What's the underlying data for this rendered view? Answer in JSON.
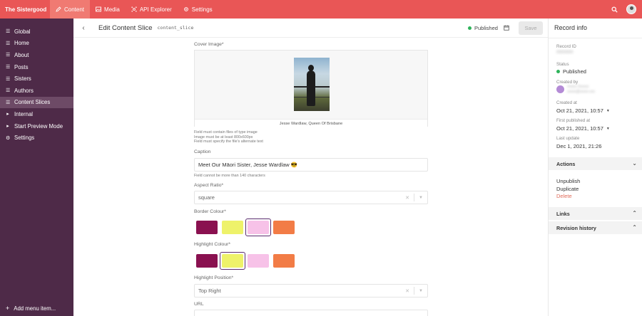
{
  "brand": "The Sistergood",
  "nav": {
    "content": "Content",
    "media": "Media",
    "api_explorer": "API Explorer",
    "settings": "Settings"
  },
  "sidebar": {
    "items": [
      {
        "label": "Global",
        "icon": "list-icon"
      },
      {
        "label": "Home",
        "icon": "list-icon"
      },
      {
        "label": "About",
        "icon": "list-icon"
      },
      {
        "label": "Posts",
        "icon": "list-icon"
      },
      {
        "label": "Sisters",
        "icon": "list-icon"
      },
      {
        "label": "Authors",
        "icon": "list-icon"
      },
      {
        "label": "Content Slices",
        "icon": "list-icon"
      },
      {
        "label": "Internal",
        "icon": "caret-right-icon"
      },
      {
        "label": "Start Preview Mode",
        "icon": "caret-right-icon"
      },
      {
        "label": "Settings",
        "icon": "gear-icon"
      }
    ],
    "add_menu": "Add menu item..."
  },
  "header": {
    "title": "Edit Content Slice",
    "code": "content_slice",
    "status": "Published",
    "save": "Save"
  },
  "form": {
    "cover_label": "Cover Image*",
    "cover_caption": "Jesse Wardlaw, Queen Of Brisbane",
    "cover_hints": [
      "Field must contain files of type image",
      "Image must be at least 800x600px",
      "Field must specify the file's alternate text"
    ],
    "caption_label": "Caption",
    "caption_value": "Meet Our Māori Sister, Jesse Wardlaw 😎",
    "caption_hint": "Field cannot be more than 140 characters",
    "aspect_label": "Aspect Ratio*",
    "aspect_value": "square",
    "border_label": "Border Colour*",
    "highlight_label": "Highlight Colour*",
    "position_label": "Highlight Position*",
    "position_value": "Top Right",
    "url_label": "URL",
    "swatch_colors": [
      "#8a1150",
      "#eef26a",
      "#f7c2e8",
      "#f27c46"
    ],
    "border_selected": 2,
    "highlight_selected": 1
  },
  "record": {
    "title": "Record info",
    "id_label": "Record ID",
    "status_label": "Status",
    "status_value": "Published",
    "created_by_label": "Created by",
    "created_at_label": "Created at",
    "created_at_value": "Oct 21, 2021, 10:57",
    "first_published_label": "First published at",
    "first_published_value": "Oct 21, 2021, 10:57",
    "last_update_label": "Last update",
    "last_update_value": "Dec 1, 2021, 21:26",
    "actions_label": "Actions",
    "unpublish": "Unpublish",
    "duplicate": "Duplicate",
    "delete": "Delete",
    "links_label": "Links",
    "revision_label": "Revision history"
  }
}
